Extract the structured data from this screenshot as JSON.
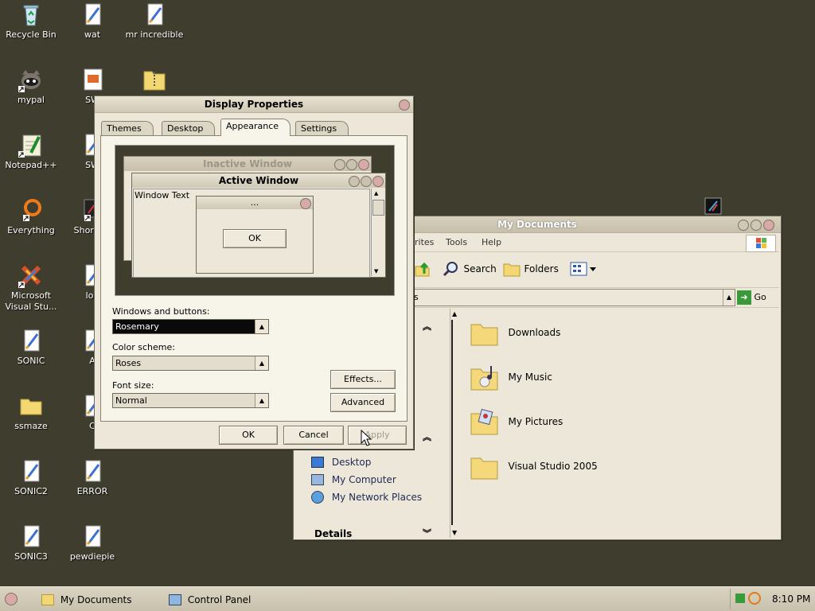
{
  "desktop": {
    "icons": [
      {
        "label": "Recycle Bin"
      },
      {
        "label": "wat"
      },
      {
        "label": "mr incredible"
      },
      {
        "label": "mypal"
      },
      {
        "label": "SW"
      },
      {
        "label": "Notepad++"
      },
      {
        "label": "SW"
      },
      {
        "label": "Everything"
      },
      {
        "label": "Shorte..."
      },
      {
        "label": "Microsoft Visual Stu..."
      },
      {
        "label": "log"
      },
      {
        "label": "SONIC"
      },
      {
        "label": "A"
      },
      {
        "label": "ssmaze"
      },
      {
        "label": "C"
      },
      {
        "label": "SONIC2"
      },
      {
        "label": "ERROR"
      },
      {
        "label": "SONIC3"
      },
      {
        "label": "pewdiepie"
      }
    ]
  },
  "display_props": {
    "title": "Display Properties",
    "tabs": [
      "Themes",
      "Desktop",
      "Appearance",
      "Settings"
    ],
    "preview": {
      "inactive_title": "Inactive Window",
      "active_title": "Active Window",
      "window_text": "Window Text",
      "msg_title": "...",
      "ok": "OK"
    },
    "windows_buttons_label": "Windows and buttons:",
    "windows_buttons_value": "Rosemary",
    "color_scheme_label": "Color scheme:",
    "color_scheme_value": "Roses",
    "font_size_label": "Font size:",
    "font_size_value": "Normal",
    "effects": "Effects...",
    "advanced": "Advanced",
    "ok": "OK",
    "cancel": "Cancel",
    "apply": "Apply"
  },
  "explorer": {
    "title": "My Documents",
    "menu": [
      "rites",
      "Tools",
      "Help"
    ],
    "toolbar": {
      "search": "Search",
      "folders": "Folders"
    },
    "address_value": "s",
    "go": "Go",
    "other_places": [
      "Desktop",
      "My Computer",
      "My Network Places"
    ],
    "details": "Details",
    "folders": [
      "Downloads",
      "My Music",
      "My Pictures",
      "Visual Studio 2005"
    ]
  },
  "taskbar": {
    "items": [
      "My Documents",
      "Control Panel"
    ],
    "time": "8:10 PM"
  },
  "colors": {
    "desktop": "#3f3d2e",
    "window": "#ece7d9",
    "accent": "#c9a3a3"
  }
}
